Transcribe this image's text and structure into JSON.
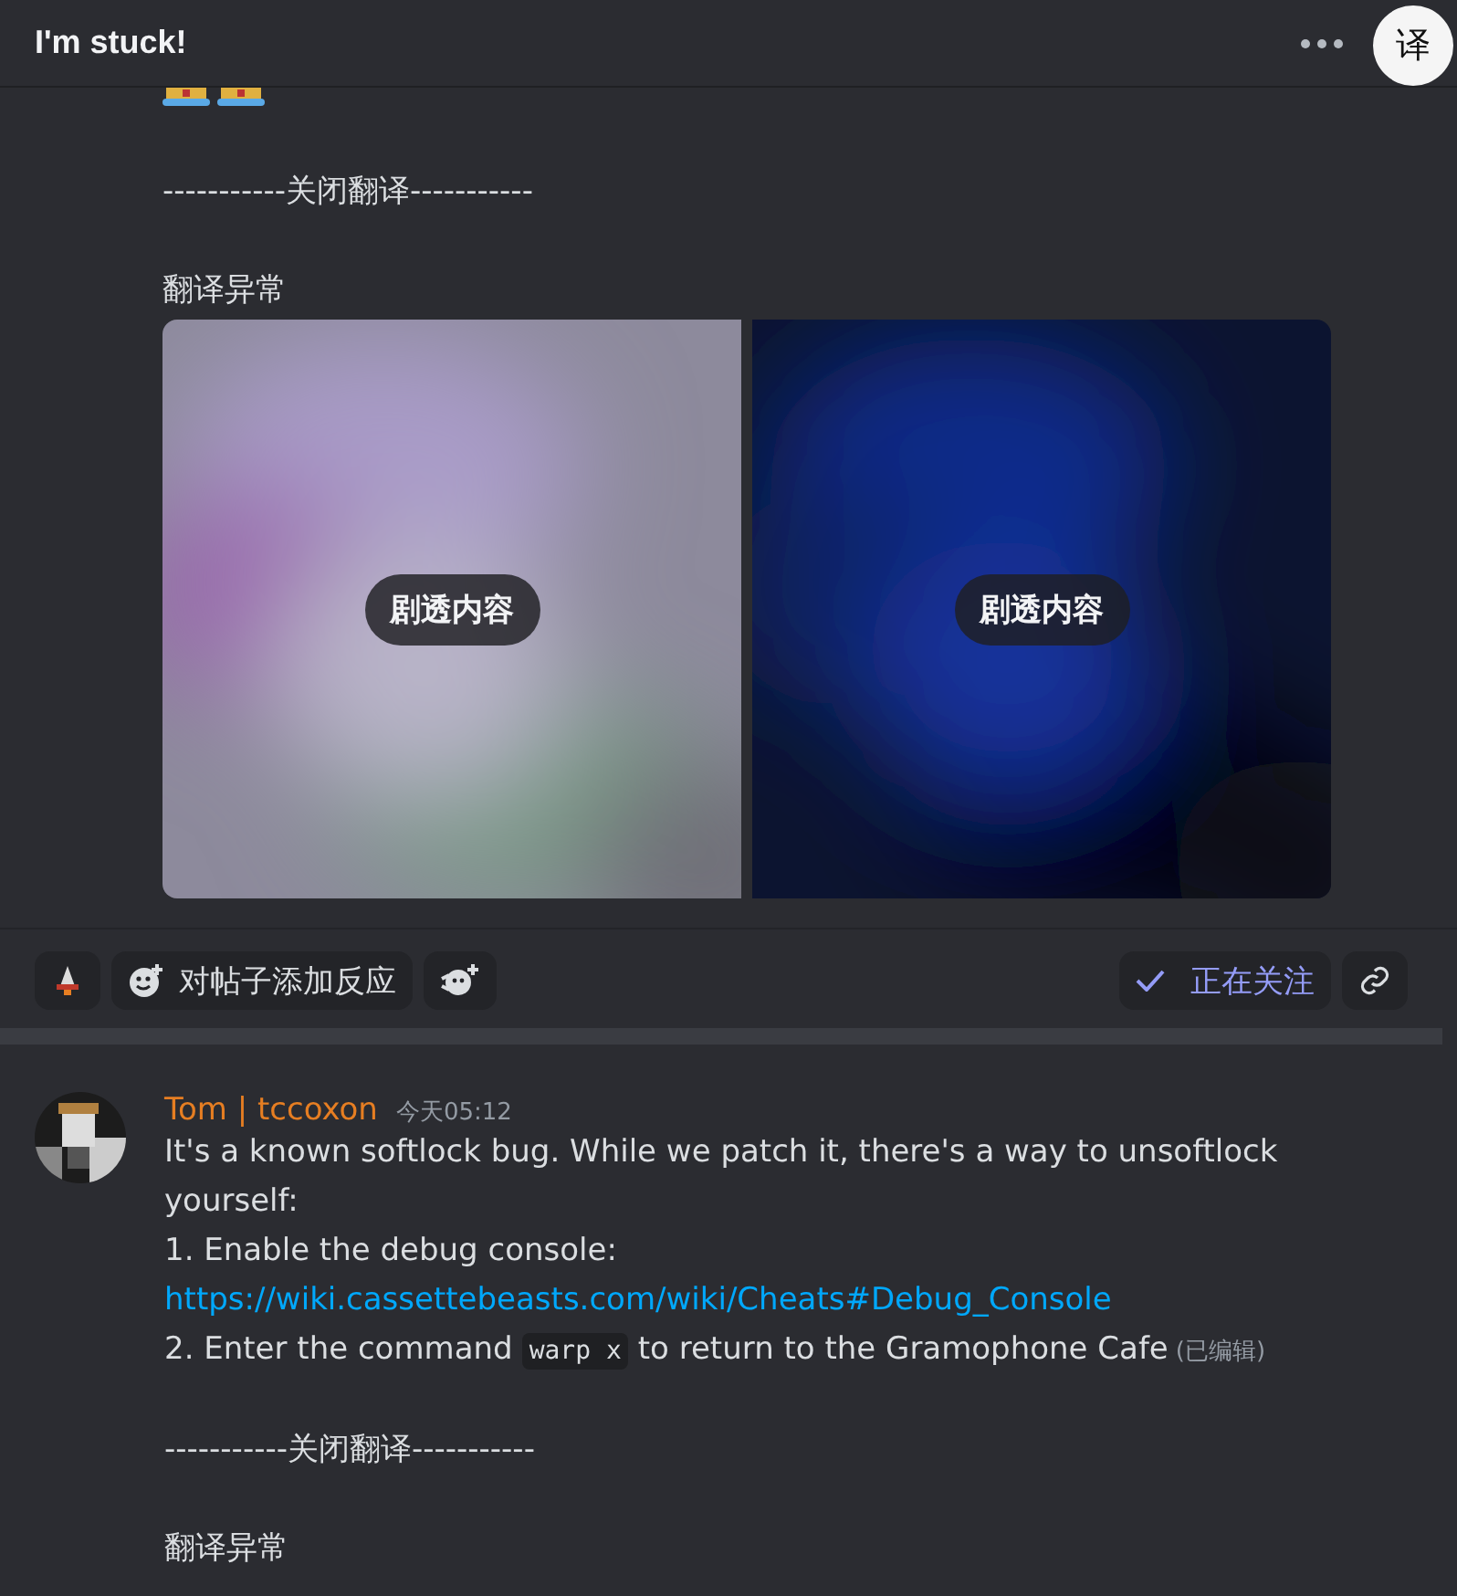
{
  "header": {
    "title": "I'm stuck!",
    "translate_button": "译"
  },
  "post": {
    "separator": "-----------关闭翻译-----------",
    "translation_status": "翻译异常",
    "images": [
      {
        "kind": "picture",
        "spoiler_label": "剧透内容"
      },
      {
        "kind": "picture",
        "spoiler_label": "剧透内容"
      }
    ],
    "actions": {
      "add_reaction": "对帖子添加反应",
      "follow": {
        "label": "正在关注",
        "selected": true
      }
    }
  },
  "message": {
    "author": "Tom | tccoxon",
    "time": "今天05:12",
    "lines": [
      {
        "kind": "text",
        "text": "It's a known softlock bug. While we patch it, there's a way to unsoftlock yourself:"
      },
      {
        "kind": "text",
        "text": "1. Enable the debug console:"
      },
      {
        "kind": "link",
        "text": "https://wiki.cassettebeasts.com/wiki/Cheats#Debug_Console"
      },
      {
        "kind": "command",
        "before": "2. Enter the command",
        "code": "warp x",
        "after": "to return to the Gramophone Cafe",
        "edited": "(已编辑)"
      }
    ],
    "separator": "-----------关闭翻译-----------",
    "translation_status": "翻译异常"
  }
}
